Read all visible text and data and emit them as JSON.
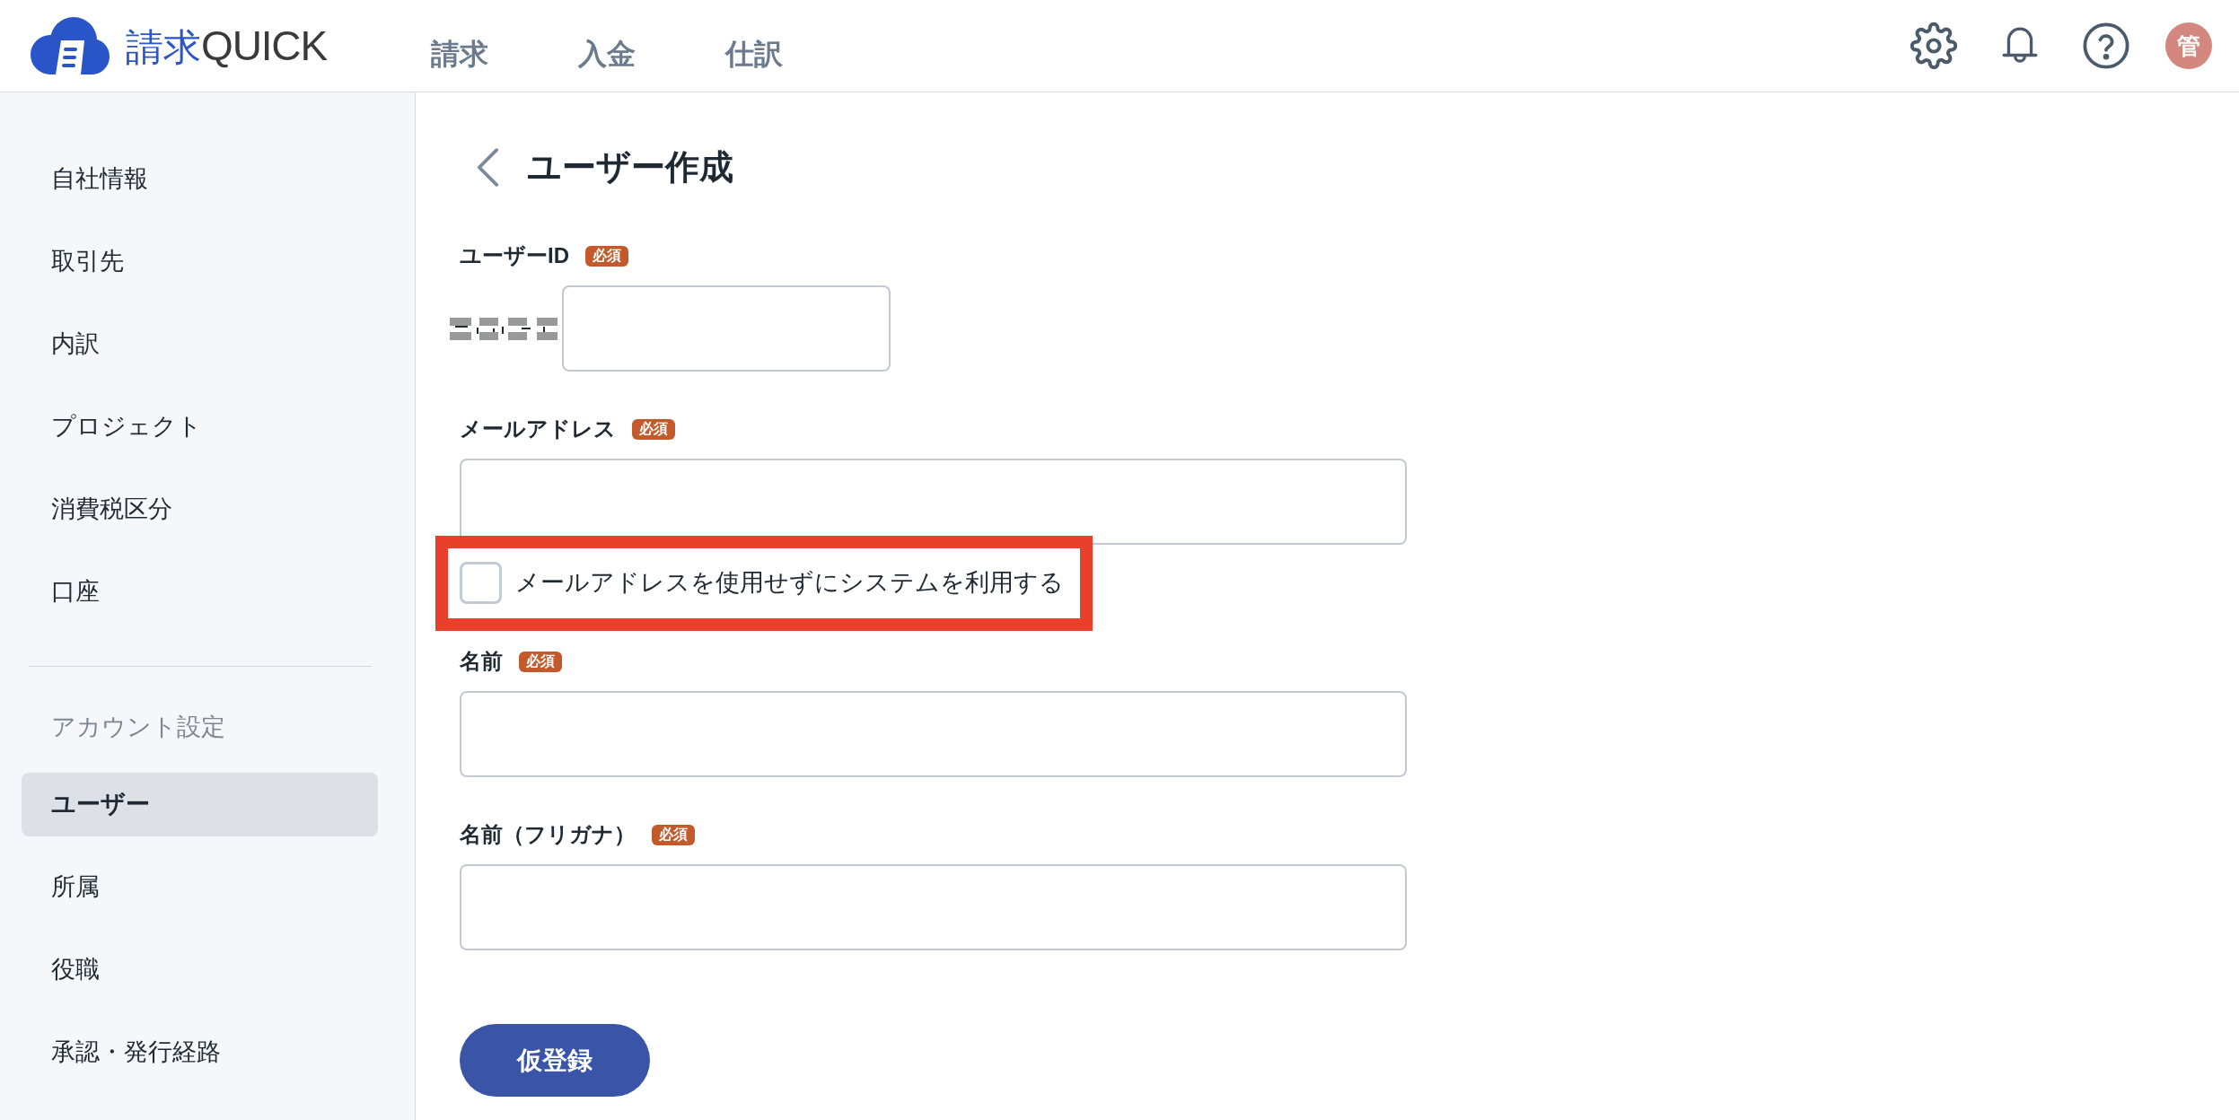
{
  "header": {
    "logo": {
      "mark": "請求",
      "word": "QUICK"
    },
    "nav": [
      {
        "label": "請求",
        "selected": false
      },
      {
        "label": "入金",
        "selected": false
      },
      {
        "label": "仕訳",
        "selected": false
      }
    ],
    "avatar": "管"
  },
  "sidebar": {
    "items": [
      {
        "label": "自社情報",
        "selected": false
      },
      {
        "label": "取引先",
        "selected": false
      },
      {
        "label": "内訳",
        "selected": false
      },
      {
        "label": "プロジェクト",
        "selected": false
      },
      {
        "label": "消費税区分",
        "selected": false
      },
      {
        "label": "口座",
        "selected": false
      }
    ],
    "section": {
      "title": "アカウント設定",
      "items": [
        {
          "label": "ユーザー",
          "selected": true
        },
        {
          "label": "所属",
          "selected": false
        },
        {
          "label": "役職",
          "selected": false
        },
        {
          "label": "承認・発行経路",
          "selected": false
        }
      ]
    }
  },
  "page": {
    "title": "ユーザー作成",
    "fields": [
      {
        "kind": "prefixed_input",
        "label": "ユーザーID",
        "badge": "必須"
      },
      {
        "kind": "input",
        "label": "メールアドレス",
        "badge": "必須"
      },
      {
        "kind": "checkbox",
        "label": "メールアドレスを使用せずにシステムを利用する",
        "checked": false,
        "highlighted": true
      },
      {
        "kind": "input",
        "label": "名前",
        "badge": "必須"
      },
      {
        "kind": "input",
        "label": "名前（フリガナ）",
        "badge": "必須"
      }
    ],
    "submit": "仮登録"
  }
}
